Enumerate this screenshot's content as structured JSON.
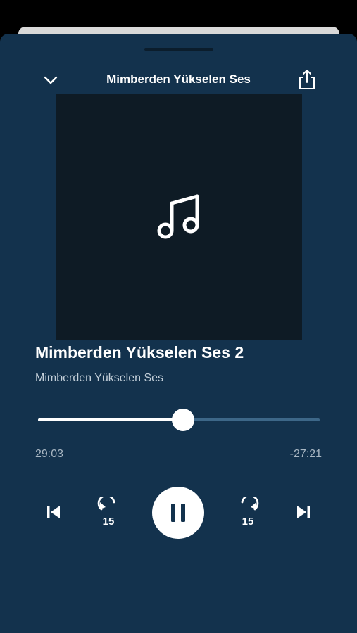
{
  "header": {
    "title": "Mimberden Yükselen Ses"
  },
  "track": {
    "title": "Mimberden Yükselen Ses 2",
    "artist": "Mimberden Yükselen Ses"
  },
  "playback": {
    "elapsed": "29:03",
    "remaining": "-27:21",
    "progress": 0.515,
    "state": "playing"
  },
  "controls": {
    "skip_back_seconds": "15",
    "skip_forward_seconds": "15"
  },
  "icons": {
    "collapse": "chevron-down-icon",
    "share": "share-icon",
    "artwork": "music-note-icon",
    "previous": "previous-track-icon",
    "back15": "skip-back-15-icon",
    "pause": "pause-icon",
    "fwd15": "skip-forward-15-icon",
    "next": "next-track-icon"
  },
  "colors": {
    "background": "#13324d",
    "artwork_bg": "#0e1b25",
    "accent": "#ffffff",
    "track_inactive": "#3d6788"
  }
}
